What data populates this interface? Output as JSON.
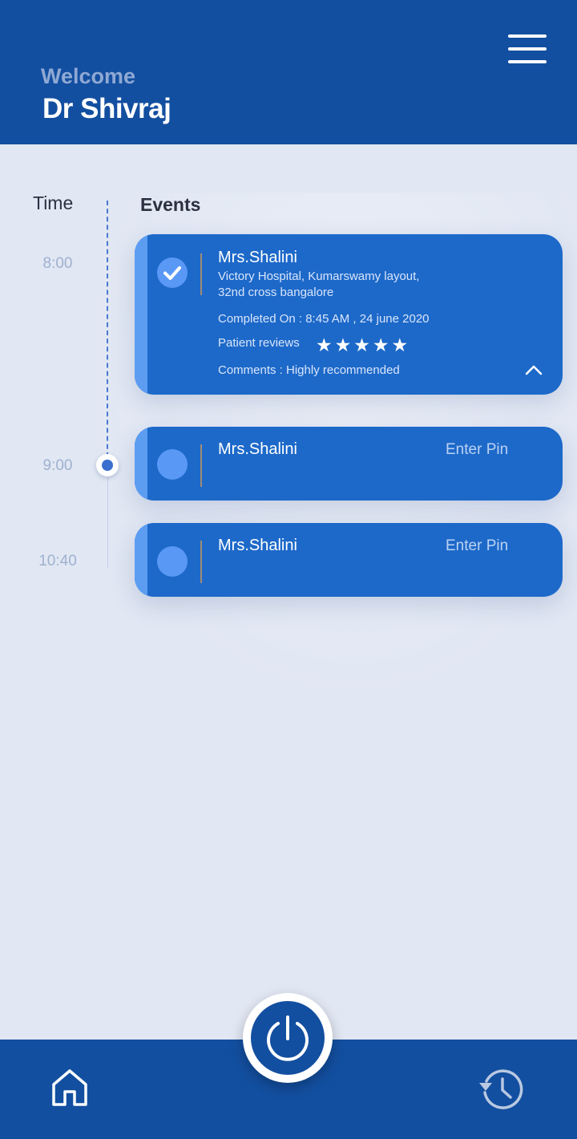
{
  "header": {
    "welcome": "Welcome",
    "doctor_name": "Dr Shivraj",
    "menu_icon": "hamburger-menu-icon"
  },
  "columns": {
    "time": "Time",
    "events": "Events"
  },
  "timeline": {
    "times": [
      "8:00",
      "9:00",
      "10:40"
    ]
  },
  "events": [
    {
      "status": "completed",
      "name": "Mrs.Shalini",
      "address_line1": "Victory Hospital, Kumarswamy layout,",
      "address_line2": "32nd cross bangalore",
      "completed_on": "Completed On : 8:45 AM , 24 june 2020",
      "reviews_label": "Patient reviews",
      "rating": 5,
      "stars": "★★★★★",
      "comments": "Comments : Highly recommended",
      "icon": "check-circle-icon"
    },
    {
      "status": "pending",
      "name": "Mrs.Shalini",
      "action": "Enter Pin"
    },
    {
      "status": "pending",
      "name": "Mrs.Shalini",
      "action": "Enter Pin"
    }
  ],
  "nav": {
    "home_icon": "home-icon",
    "power_icon": "power-icon",
    "history_icon": "history-icon"
  },
  "colors": {
    "primary": "#134fa0",
    "card": "#1d69c9",
    "accent": "#5c9df2",
    "background": "#e1e7f3"
  }
}
